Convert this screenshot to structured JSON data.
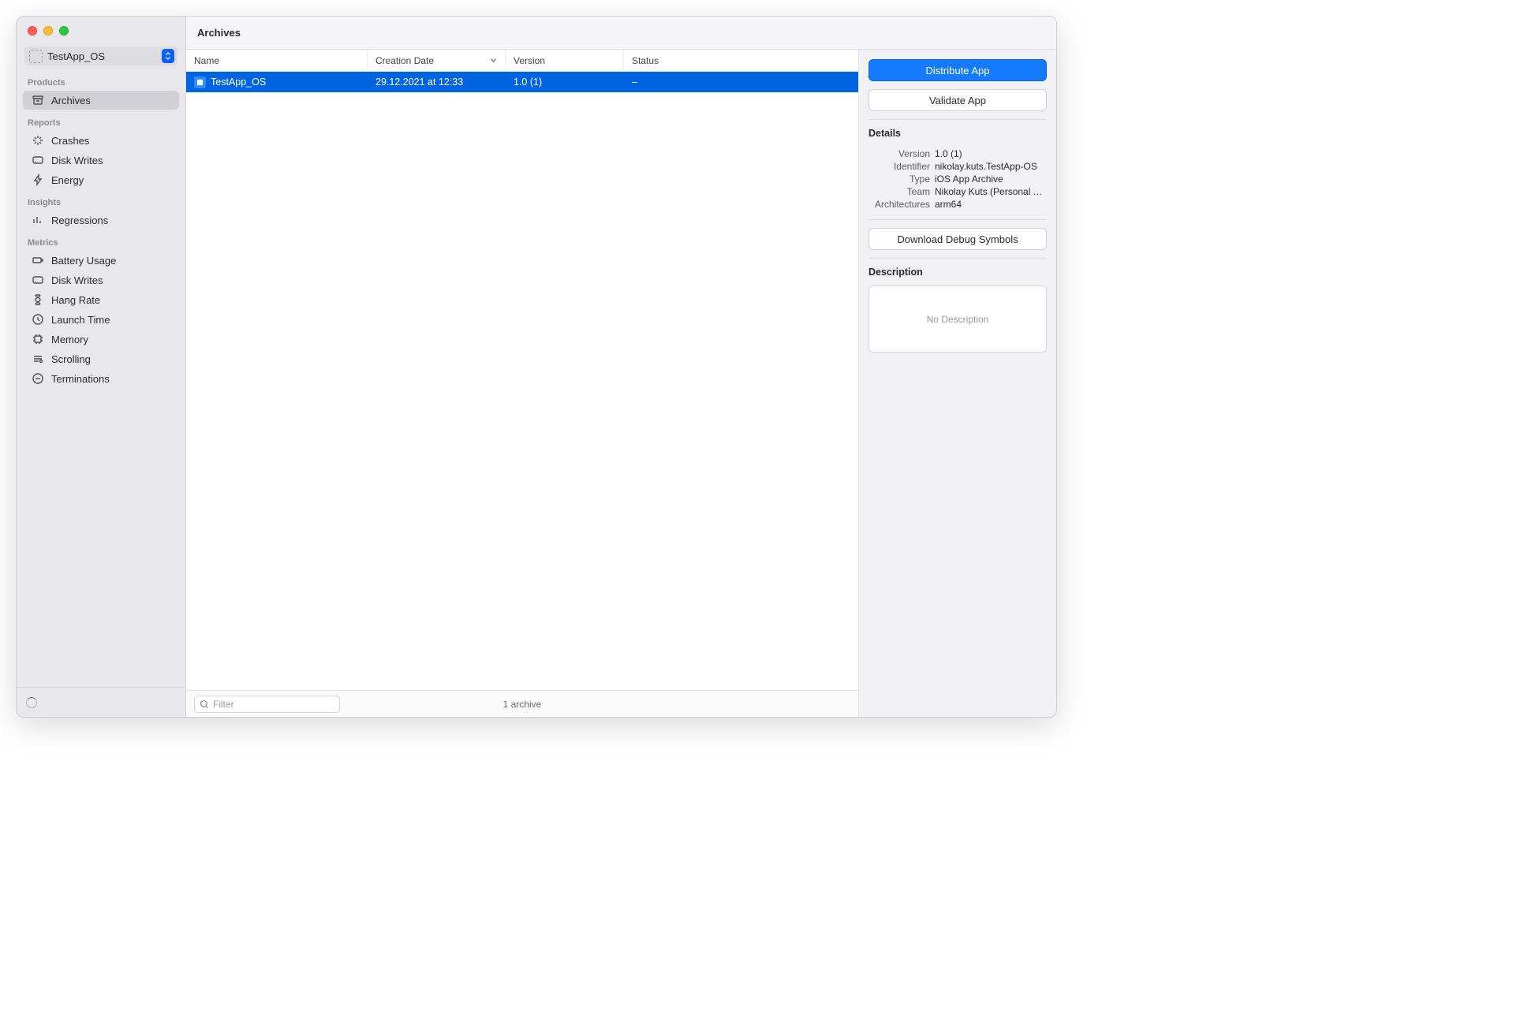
{
  "window": {
    "title": "Archives"
  },
  "project_selector": {
    "name": "TestApp_OS"
  },
  "sidebar": {
    "sections": [
      {
        "heading": "Products",
        "items": [
          {
            "id": "archives",
            "label": "Archives",
            "icon": "archive",
            "selected": true
          }
        ]
      },
      {
        "heading": "Reports",
        "items": [
          {
            "id": "crashes",
            "label": "Crashes",
            "icon": "crash"
          },
          {
            "id": "disk-writes-r",
            "label": "Disk Writes",
            "icon": "disk"
          },
          {
            "id": "energy",
            "label": "Energy",
            "icon": "bolt"
          }
        ]
      },
      {
        "heading": "Insights",
        "items": [
          {
            "id": "regressions",
            "label": "Regressions",
            "icon": "bars"
          }
        ]
      },
      {
        "heading": "Metrics",
        "items": [
          {
            "id": "battery",
            "label": "Battery Usage",
            "icon": "battery"
          },
          {
            "id": "disk-writes-m",
            "label": "Disk Writes",
            "icon": "disk"
          },
          {
            "id": "hang",
            "label": "Hang Rate",
            "icon": "hourglass"
          },
          {
            "id": "launch",
            "label": "Launch Time",
            "icon": "clock"
          },
          {
            "id": "memory",
            "label": "Memory",
            "icon": "chip"
          },
          {
            "id": "scrolling",
            "label": "Scrolling",
            "icon": "scroll"
          },
          {
            "id": "terminations",
            "label": "Terminations",
            "icon": "stop"
          }
        ]
      }
    ]
  },
  "table": {
    "columns": {
      "name": "Name",
      "creation_date": "Creation Date",
      "version": "Version",
      "status": "Status"
    },
    "rows": [
      {
        "name": "TestApp_OS",
        "creation_date": "29.12.2021 at 12:33",
        "version": "1.0 (1)",
        "status": "–",
        "selected": true
      }
    ],
    "footer": {
      "filter_placeholder": "Filter",
      "count_label": "1 archive"
    }
  },
  "inspector": {
    "distribute_label": "Distribute App",
    "validate_label": "Validate App",
    "details_heading": "Details",
    "details": {
      "version_k": "Version",
      "version_v": "1.0 (1)",
      "identifier_k": "Identifier",
      "identifier_v": "nikolay.kuts.TestApp-OS",
      "type_k": "Type",
      "type_v": "iOS App Archive",
      "team_k": "Team",
      "team_v": "Nikolay Kuts (Personal T…",
      "arch_k": "Architectures",
      "arch_v": "arm64"
    },
    "download_symbols_label": "Download Debug Symbols",
    "description_heading": "Description",
    "no_description": "No Description"
  }
}
